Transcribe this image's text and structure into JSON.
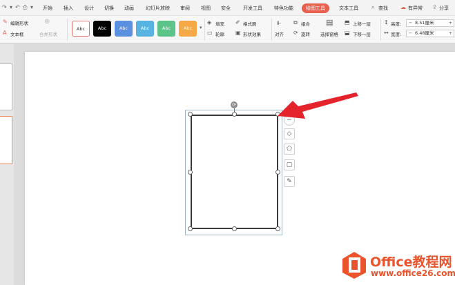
{
  "tabs": [
    "开始",
    "插入",
    "设计",
    "切换",
    "动画",
    "幻灯片放映",
    "审阅",
    "视图",
    "安全",
    "开发工具",
    "特色功能",
    "绘图工具",
    "文本工具"
  ],
  "active_tab": "绘图工具",
  "search_label": "查找",
  "right_menu": {
    "anomaly": "有异常",
    "share": "分享"
  },
  "ribbon": {
    "edit_shape": "编辑形状",
    "text_box": "文本框",
    "merge_shape": "合并形状",
    "style_sample": "Abc",
    "fill": "填充",
    "format_painter": "格式刷",
    "outline": "轮廓",
    "shape_effect": "形状效果",
    "align": "对齐",
    "group": "组合",
    "rotate": "旋转",
    "selection_pane": "选择窗格",
    "bring_forward": "上移一层",
    "send_backward": "下移一层",
    "height_label": "高度:",
    "height_value": "8.51厘米",
    "width_label": "宽度:",
    "width_value": "6.48厘米"
  },
  "styles": [
    {
      "bg": "#ffffff",
      "fg": "#333333",
      "border": "#e57373"
    },
    {
      "bg": "#000000",
      "fg": "#ffffff",
      "border": "#000000"
    },
    {
      "bg": "#5b8fe0",
      "fg": "#ffffff",
      "border": "#5b8fe0"
    },
    {
      "bg": "#59b3e0",
      "fg": "#ffffff",
      "border": "#59b3e0"
    },
    {
      "bg": "#5cc389",
      "fg": "#ffffff",
      "border": "#5cc389"
    },
    {
      "bg": "#f5a946",
      "fg": "#ffffff",
      "border": "#f5a946"
    }
  ],
  "watermark": {
    "brand": "Office教程网",
    "url": "www.office26.com"
  },
  "colors": {
    "accent": "#e8614e",
    "arrow": "#e5232d",
    "logo": "#e9542d"
  }
}
